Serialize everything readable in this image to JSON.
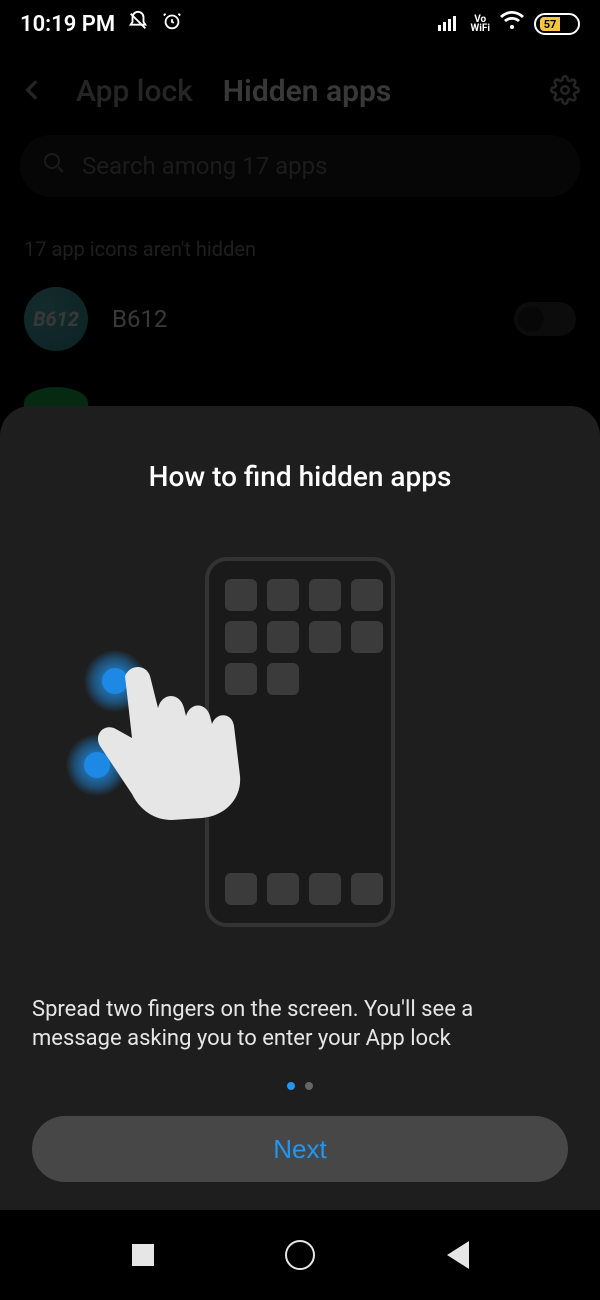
{
  "status": {
    "time": "10:19 PM",
    "battery_level": "57",
    "vo_wifi": "Vo\nWiFi"
  },
  "nav": {
    "tab_lock": "App lock",
    "tab_hidden": "Hidden apps"
  },
  "search": {
    "placeholder": "Search among 17 apps"
  },
  "section_label": "17 app icons aren't hidden",
  "apps": {
    "b612": {
      "name": "B612",
      "icon_text": "B612"
    }
  },
  "tutorial": {
    "title": "How to find hidden apps",
    "desc": "Spread two fingers on the screen. You'll see a message asking you to enter your App lock",
    "next_label": "Next"
  }
}
